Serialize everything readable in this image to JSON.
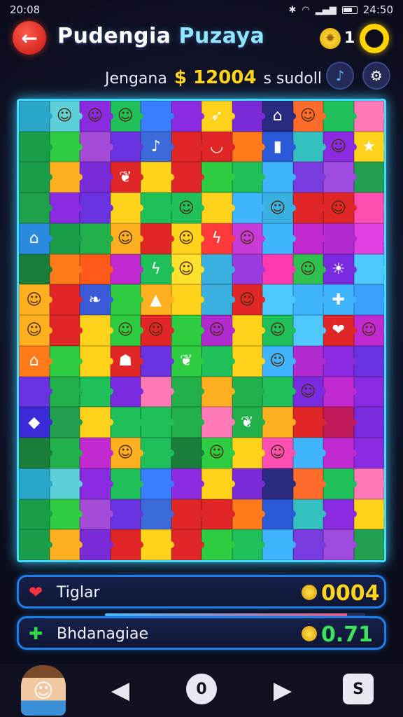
{
  "status": {
    "time": "20:08",
    "clock_right": "24:50"
  },
  "header": {
    "title_part1": "Pudengia",
    "title_part2": "Puzaya",
    "coin_count": "1"
  },
  "subheader": {
    "label": "Jengana",
    "amount": "$ 12004",
    "suffix": "s sudoll"
  },
  "board": {
    "rows": 15,
    "cols": 12,
    "tiles": [
      [
        "#2aa7c9",
        "#5bd0d8",
        "#8a2be2",
        "#1fbf5a",
        "#3a7dff",
        "#8a2be2",
        "#ffd21c",
        "#7a2bd8",
        "#2a2a80",
        "#ff6b2b",
        "#1fbf5a",
        "#ff7ab6"
      ],
      [
        "#1a9e4a",
        "#2ecc40",
        "#a44bd8",
        "#6a32e0",
        "#3b6bd8",
        "#e02626",
        "#e02626",
        "#ff7a1a",
        "#2a5ad8",
        "#35c0c0",
        "#8a2be2",
        "#ffd21c"
      ],
      [
        "#1a9e4a",
        "#ffb020",
        "#7a2bd8",
        "#e02626",
        "#ffd21c",
        "#e02626",
        "#2ecc40",
        "#1fbf5a",
        "#40b4ff",
        "#7a3be0",
        "#a04be0",
        "#22a050"
      ],
      [
        "#1fa04a",
        "#8a2be2",
        "#6a32e0",
        "#ffd21c",
        "#1fbf5a",
        "#1fbf5a",
        "#ffd21c",
        "#40b4ff",
        "#3ab0e0",
        "#e02626",
        "#e02626",
        "#ff4fb0"
      ],
      [
        "#2a8ae0",
        "#1a9e4a",
        "#22b04a",
        "#ffb020",
        "#e02626",
        "#ffd21c",
        "#ff3a3a",
        "#c83ad8",
        "#40b4ff",
        "#c02ad0",
        "#b02ad0",
        "#e040e0"
      ],
      [
        "#1a7e3a",
        "#ff7a1a",
        "#ff5a1a",
        "#c02ad0",
        "#1fbf5a",
        "#ffe02c",
        "#3ab0e0",
        "#9a3be0",
        "#ff3ab0",
        "#30c050",
        "#7a2be0",
        "#4fc8ff"
      ],
      [
        "#ffb020",
        "#e02626",
        "#3a5ad8",
        "#2ecc40",
        "#ffb020",
        "#ffd21c",
        "#3ab0e0",
        "#e02626",
        "#4fc8ff",
        "#40b4ff",
        "#40b4ff",
        "#3aa0ff"
      ],
      [
        "#ffb020",
        "#e02626",
        "#ffd21c",
        "#2ecc40",
        "#e02626",
        "#2ecc40",
        "#b02ad0",
        "#ffd21c",
        "#1fbf5a",
        "#4fc8ff",
        "#e02626",
        "#c02ad0"
      ],
      [
        "#ff7a1a",
        "#2ecc40",
        "#ffd21c",
        "#e02626",
        "#6a32e0",
        "#2ecc40",
        "#1fbf5a",
        "#ffd21c",
        "#40b4ff",
        "#b02ad0",
        "#8a2be2",
        "#6a32e0"
      ],
      [
        "#6a32e0",
        "#22b04a",
        "#1fbf5a",
        "#7a2be0",
        "#ff7ab6",
        "#22b04a",
        "#ffb020",
        "#22b04a",
        "#1fbf5a",
        "#7a2be0",
        "#c02ad0",
        "#8a2be2"
      ],
      [
        "#3a2ad8",
        "#22a050",
        "#ffd21c",
        "#1fbf5a",
        "#1fbf5a",
        "#22b04a",
        "#ff7ab6",
        "#22b04a",
        "#ffb020",
        "#e02626",
        "#c01a5a",
        "#7a2be0"
      ],
      [
        "#1a7e3a",
        "#22b04a",
        "#c02ad0",
        "#ffb020",
        "#1fbf5a",
        "#1a7e3a",
        "#2ecc40",
        "#ffd21c",
        "#ff4fb0",
        "#40b4ff",
        "#c02ad0",
        "#8a2be2"
      ]
    ],
    "icons": [
      [
        null,
        "face-icon",
        "face-icon",
        "face-icon",
        null,
        null,
        "rocket-icon",
        null,
        "house-icon",
        "face-icon",
        null,
        null
      ],
      [
        null,
        null,
        null,
        null,
        "note-icon",
        null,
        "bowl-icon",
        null,
        "block-icon",
        null,
        "face-icon",
        "star-icon"
      ],
      [
        null,
        null,
        null,
        "feather-icon",
        null,
        null,
        null,
        null,
        null,
        null,
        null,
        null
      ],
      [
        null,
        null,
        null,
        null,
        null,
        "face-icon",
        null,
        null,
        "face-icon",
        null,
        "face-icon",
        null
      ],
      [
        "house-icon",
        null,
        null,
        "face-icon",
        null,
        "face-icon",
        "bolt-icon",
        "face-icon",
        null,
        null,
        null,
        null
      ],
      [
        null,
        null,
        null,
        null,
        "bolt-icon",
        "face-icon",
        null,
        null,
        null,
        "face-icon",
        "sun-icon",
        null
      ],
      [
        "face-icon",
        null,
        "leaf-icon",
        null,
        "hat-icon",
        null,
        null,
        "face-icon",
        null,
        null,
        "plus-icon",
        null
      ],
      [
        "face-icon",
        null,
        null,
        "face-icon",
        "face-icon",
        null,
        "face-icon",
        null,
        "face-icon",
        null,
        "heart-icon",
        "face-icon"
      ],
      [
        "house-icon",
        null,
        null,
        "robot-icon",
        null,
        "feather-icon",
        null,
        null,
        "face-icon",
        null,
        null,
        null
      ],
      [
        null,
        null,
        null,
        null,
        null,
        null,
        null,
        null,
        null,
        "face-icon",
        null,
        null
      ],
      [
        "gem-icon",
        null,
        null,
        null,
        null,
        null,
        null,
        "feather-icon",
        null,
        null,
        null,
        null
      ],
      [
        null,
        null,
        null,
        "face-icon",
        null,
        null,
        "face-icon",
        null,
        "face-icon",
        null,
        null,
        null
      ]
    ],
    "glyphs": {
      "face-icon": "☺",
      "rocket-icon": "➶",
      "house-icon": "⌂",
      "note-icon": "♪",
      "bowl-icon": "◡",
      "block-icon": "▮",
      "star-icon": "★",
      "feather-icon": "❦",
      "bolt-icon": "ϟ",
      "sun-icon": "☀",
      "leaf-icon": "❧",
      "hat-icon": "▲",
      "plus-icon": "✚",
      "heart-icon": "❤",
      "robot-icon": "☗",
      "gem-icon": "◆"
    }
  },
  "stats": {
    "row1": {
      "label": "Tiglar",
      "value": "0004",
      "icon": "heart-icon"
    },
    "row2": {
      "label": "Bhdanagiae",
      "value": "0.71",
      "icon": "puzzle-icon"
    },
    "progress": 0.93
  },
  "nav": {
    "prev_glyph": "◀",
    "mid_glyph": "0",
    "next_glyph": "▶",
    "menu_glyph": "S"
  }
}
